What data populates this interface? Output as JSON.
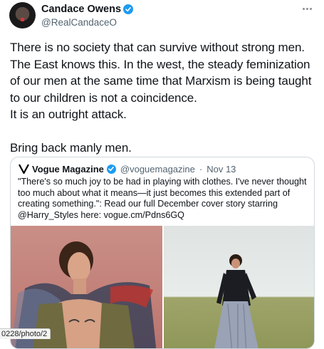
{
  "author": {
    "name": "Candace Owens",
    "handle": "@RealCandaceO",
    "verified_color": "#1d9bf0"
  },
  "tweet_text": "There is no society that can survive without strong men. The East knows this. In the west, the steady feminization of our men at the same time that Marxism is being taught to our children is not a coincidence.\nIt is an outright attack.\n\nBring back manly men.",
  "quoted_tweet": {
    "name": "Vogue Magazine",
    "handle": "@voguemagazine",
    "separator": "·",
    "date": "Nov 13",
    "text": "\"There's so much joy to be had in playing with clothes. I've never thought too much about what it means—it just becomes this extended part of creating something.\": Read our full December cover story starring @Harry_Styles here: vogue.cm/Pdns6GQ"
  },
  "status_bar_url": "0228/photo/2",
  "icons": {
    "verified": "verified-badge-icon",
    "more": "more-options-icon",
    "vogue_logo": "vogue-logo-icon"
  }
}
